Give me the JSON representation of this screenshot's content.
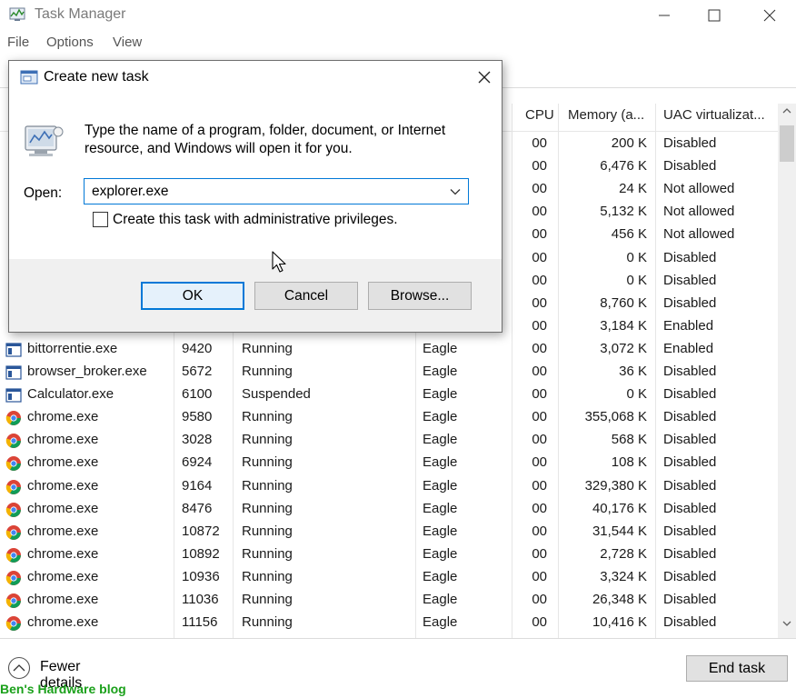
{
  "window": {
    "title": "Task Manager",
    "menu": [
      "File",
      "Options",
      "View"
    ]
  },
  "table": {
    "headers": {
      "cpu": "CPU",
      "memory": "Memory (a...",
      "uac": "UAC virtualizat..."
    },
    "rows": [
      {
        "name": "",
        "pid": "",
        "status": "",
        "user": "",
        "cpu": "00",
        "memory": "200 K",
        "uac": "Disabled",
        "icon": "generic-icon"
      },
      {
        "name": "",
        "pid": "",
        "status": "",
        "user": "",
        "cpu": "00",
        "memory": "6,476 K",
        "uac": "Disabled",
        "icon": "generic-icon"
      },
      {
        "name": "",
        "pid": "",
        "status": "",
        "user": "",
        "cpu": "00",
        "memory": "24 K",
        "uac": "Not allowed",
        "icon": "generic-icon"
      },
      {
        "name": "",
        "pid": "",
        "status": "",
        "user": "",
        "cpu": "00",
        "memory": "5,132 K",
        "uac": "Not allowed",
        "icon": "generic-icon"
      },
      {
        "name": "",
        "pid": "",
        "status": "",
        "user": "",
        "cpu": "00",
        "memory": "456 K",
        "uac": "Not allowed",
        "icon": "generic-icon"
      },
      {
        "name": "",
        "pid": "",
        "status": "",
        "user": "",
        "cpu": "00",
        "memory": "0 K",
        "uac": "Disabled",
        "icon": "generic-icon"
      },
      {
        "name": "",
        "pid": "",
        "status": "",
        "user": "",
        "cpu": "00",
        "memory": "0 K",
        "uac": "Disabled",
        "icon": "generic-icon"
      },
      {
        "name": "",
        "pid": "",
        "status": "",
        "user": "",
        "cpu": "00",
        "memory": "8,760 K",
        "uac": "Disabled",
        "icon": "generic-icon"
      },
      {
        "name": "",
        "pid": "",
        "status": "",
        "user": "",
        "cpu": "00",
        "memory": "3,184 K",
        "uac": "Enabled",
        "icon": "generic-icon"
      },
      {
        "name": "bittorrentie.exe",
        "pid": "9420",
        "status": "Running",
        "user": "Eagle",
        "cpu": "00",
        "memory": "3,072 K",
        "uac": "Enabled",
        "icon": "app-window-icon"
      },
      {
        "name": "browser_broker.exe",
        "pid": "5672",
        "status": "Running",
        "user": "Eagle",
        "cpu": "00",
        "memory": "36 K",
        "uac": "Disabled",
        "icon": "app-window-icon"
      },
      {
        "name": "Calculator.exe",
        "pid": "6100",
        "status": "Suspended",
        "user": "Eagle",
        "cpu": "00",
        "memory": "0 K",
        "uac": "Disabled",
        "icon": "app-window-icon"
      },
      {
        "name": "chrome.exe",
        "pid": "9580",
        "status": "Running",
        "user": "Eagle",
        "cpu": "00",
        "memory": "355,068 K",
        "uac": "Disabled",
        "icon": "chrome-icon"
      },
      {
        "name": "chrome.exe",
        "pid": "3028",
        "status": "Running",
        "user": "Eagle",
        "cpu": "00",
        "memory": "568 K",
        "uac": "Disabled",
        "icon": "chrome-icon"
      },
      {
        "name": "chrome.exe",
        "pid": "6924",
        "status": "Running",
        "user": "Eagle",
        "cpu": "00",
        "memory": "108 K",
        "uac": "Disabled",
        "icon": "chrome-icon"
      },
      {
        "name": "chrome.exe",
        "pid": "9164",
        "status": "Running",
        "user": "Eagle",
        "cpu": "00",
        "memory": "329,380 K",
        "uac": "Disabled",
        "icon": "chrome-icon"
      },
      {
        "name": "chrome.exe",
        "pid": "8476",
        "status": "Running",
        "user": "Eagle",
        "cpu": "00",
        "memory": "40,176 K",
        "uac": "Disabled",
        "icon": "chrome-icon"
      },
      {
        "name": "chrome.exe",
        "pid": "10872",
        "status": "Running",
        "user": "Eagle",
        "cpu": "00",
        "memory": "31,544 K",
        "uac": "Disabled",
        "icon": "chrome-icon"
      },
      {
        "name": "chrome.exe",
        "pid": "10892",
        "status": "Running",
        "user": "Eagle",
        "cpu": "00",
        "memory": "2,728 K",
        "uac": "Disabled",
        "icon": "chrome-icon"
      },
      {
        "name": "chrome.exe",
        "pid": "10936",
        "status": "Running",
        "user": "Eagle",
        "cpu": "00",
        "memory": "3,324 K",
        "uac": "Disabled",
        "icon": "chrome-icon"
      },
      {
        "name": "chrome.exe",
        "pid": "11036",
        "status": "Running",
        "user": "Eagle",
        "cpu": "00",
        "memory": "26,348 K",
        "uac": "Disabled",
        "icon": "chrome-icon"
      },
      {
        "name": "chrome.exe",
        "pid": "11156",
        "status": "Running",
        "user": "Eagle",
        "cpu": "00",
        "memory": "10,416 K",
        "uac": "Disabled",
        "icon": "chrome-icon"
      }
    ]
  },
  "footer": {
    "fewer_details": "Fewer details",
    "end_task": "End task",
    "watermark": "Ben's Hardware blog"
  },
  "dialog": {
    "title": "Create new task",
    "description": "Type the name of a program, folder, document, or Internet resource, and Windows will open it for you.",
    "open_label": "Open:",
    "open_value": "explorer.exe",
    "admin_checkbox_label": "Create this task with administrative privileges.",
    "admin_checked": false,
    "ok": "OK",
    "cancel": "Cancel",
    "browse": "Browse..."
  },
  "colors": {
    "accent": "#0078d7",
    "watermark": "#1aa01a"
  }
}
